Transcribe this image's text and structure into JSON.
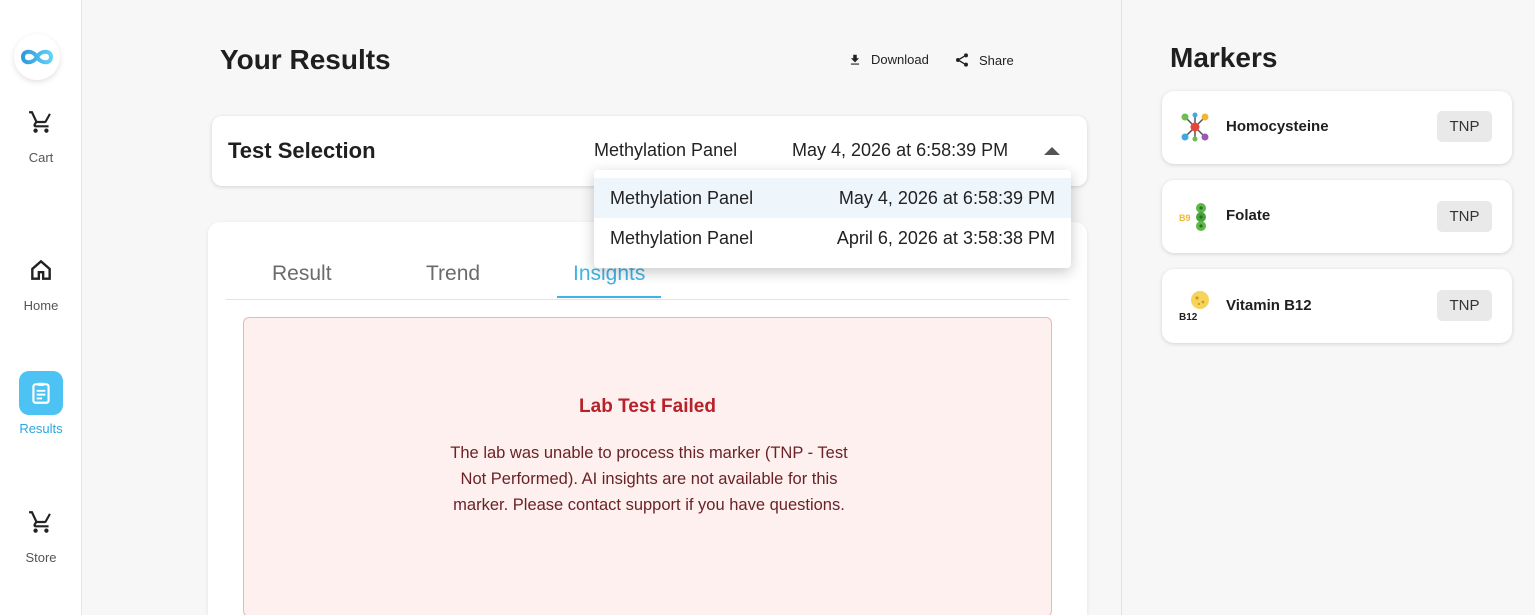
{
  "nav": {
    "items": [
      {
        "label": "Cart",
        "icon": "cart-icon"
      },
      {
        "label": "Home",
        "icon": "home-icon"
      },
      {
        "label": "Results",
        "icon": "clipboard-icon"
      },
      {
        "label": "Store",
        "icon": "cart-icon"
      }
    ],
    "active_color": "#4cc3f3"
  },
  "header": {
    "title": "Your Results",
    "download_label": "Download",
    "share_label": "Share"
  },
  "test_selection": {
    "label": "Test Selection",
    "panel": "Methylation Panel",
    "date": "May 4, 2026 at 6:58:39 PM",
    "options": [
      {
        "panel": "Methylation Panel",
        "date": "May 4, 2026 at 6:58:39 PM",
        "selected": true
      },
      {
        "panel": "Methylation Panel",
        "date": "April 6, 2026 at 3:58:38 PM",
        "selected": false
      }
    ]
  },
  "tabs": [
    {
      "label": "Result",
      "active": false
    },
    {
      "label": "Trend",
      "active": false
    },
    {
      "label": "Insights",
      "active": true
    }
  ],
  "insight": {
    "title": "Lab Test Failed",
    "message": "The lab was unable to process this marker (TNP - Test Not Performed). AI insights are not available for this marker. Please contact support if you have questions."
  },
  "markers": {
    "title": "Markers",
    "items": [
      {
        "name": "Homocysteine",
        "status": "TNP",
        "icon": "molecule-icon"
      },
      {
        "name": "Folate",
        "status": "TNP",
        "icon": "folate-b9-icon"
      },
      {
        "name": "Vitamin B12",
        "status": "TNP",
        "icon": "vitamin-b12-icon"
      }
    ]
  },
  "colors": {
    "accent": "#3fb5e6",
    "error_text": "#b8202a",
    "error_bg": "#fdf0ef"
  }
}
